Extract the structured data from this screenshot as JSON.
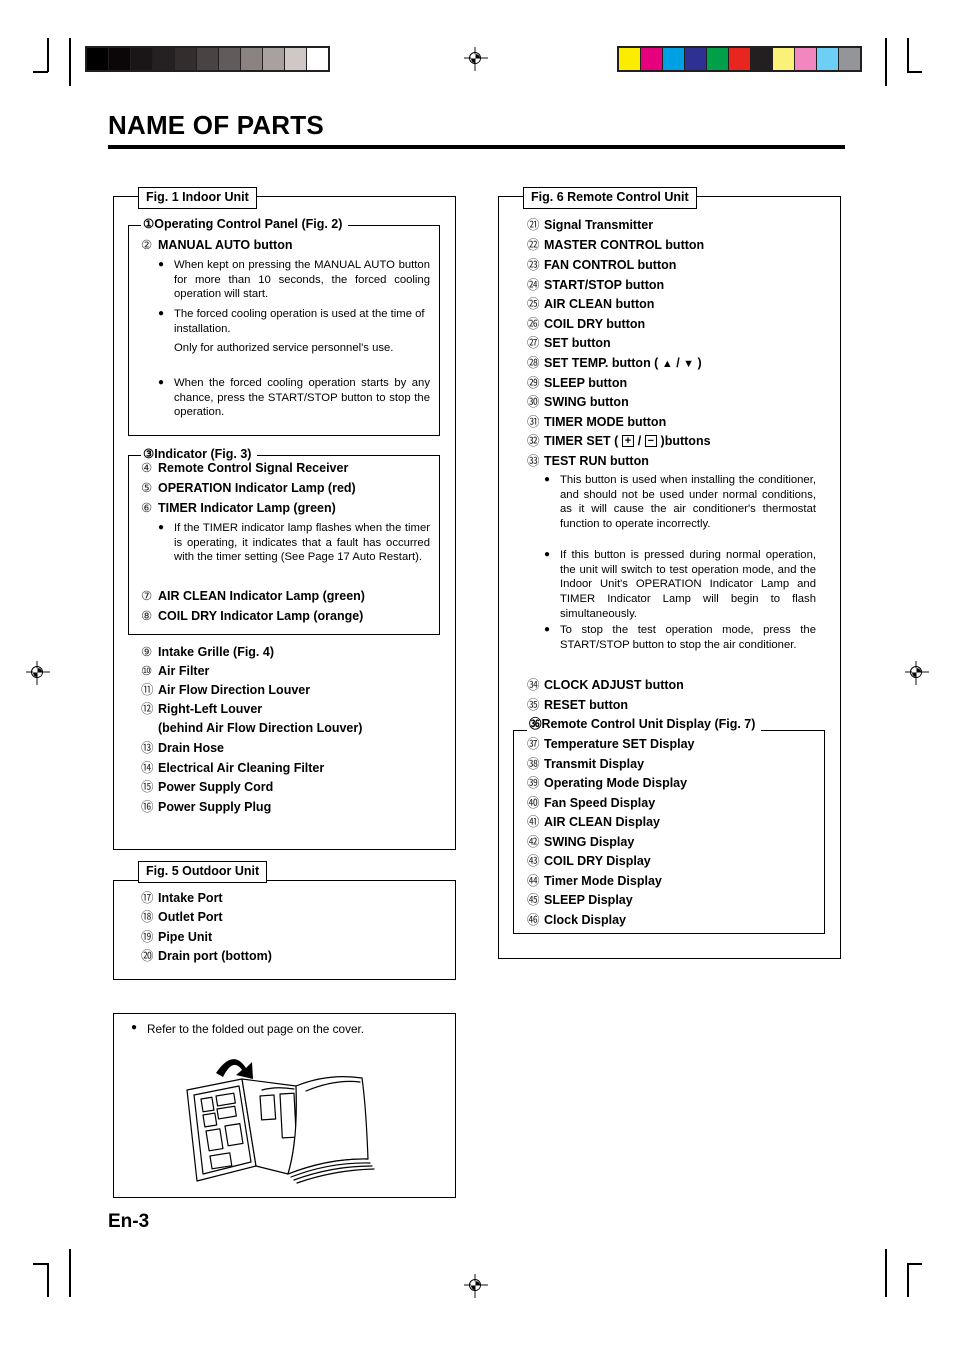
{
  "page": {
    "title": "NAME OF PARTS",
    "folio": "En-3"
  },
  "calibration": {
    "grayscale_bar": [
      "#000000",
      "#0b0708",
      "#1a1517",
      "#252022",
      "#332d2e",
      "#4a4344",
      "#625b5b",
      "#8a8382",
      "#a9a19f",
      "#cfc8c5",
      "#ffffff"
    ],
    "color_bar": [
      "#fced00",
      "#e6007e",
      "#00a0e4",
      "#2e3192",
      "#00a04a",
      "#e8251f",
      "#231f20",
      "#fbf07a",
      "#f287c0",
      "#6dcff6",
      "#939598"
    ]
  },
  "indoor_unit": {
    "label": "Fig. 1 Indoor Unit",
    "control_panel_group": {
      "label": "① Operating Control Panel (Fig. 2)",
      "items": [
        {
          "num": "①",
          "text": "Operating Control Panel (Fig. 2)"
        },
        {
          "num": "②",
          "text": "MANUAL AUTO button"
        }
      ],
      "bullets": [
        "When kept on pressing the MANUAL AUTO button for more than 10 seconds, the forced cooling operation will start.",
        "The forced cooling operation is used at the time of installation.",
        "Only for authorized service personnel's use.",
        "When the forced cooling operation starts by any chance, press the START/STOP button to stop the operation."
      ]
    },
    "indicator_group": {
      "label": "Indicator (Fig. 3)",
      "label_num": "③",
      "items": [
        {
          "num": "④",
          "text": "Remote Control Signal Receiver"
        },
        {
          "num": "⑤",
          "text": "OPERATION Indicator Lamp (red)"
        },
        {
          "num": "⑥",
          "text": "TIMER Indicator Lamp (green)"
        }
      ],
      "bullets": [
        "If the TIMER indicator lamp flashes when the timer is operating, it indicates that a fault has occurred with the timer setting (See Page 17 Auto Restart)."
      ],
      "items_after": [
        {
          "num": "⑦",
          "text": "AIR CLEAN Indicator Lamp (green)"
        },
        {
          "num": "⑧",
          "text": "COIL DRY Indicator Lamp (orange)"
        }
      ]
    },
    "items": [
      {
        "num": "⑨",
        "text": "Intake Grille (Fig. 4)"
      },
      {
        "num": "⑩",
        "text": "Air Filter"
      },
      {
        "num": "⑪",
        "text": "Air Flow Direction Louver"
      },
      {
        "num": "⑫",
        "text": "Right-Left Louver"
      },
      {
        "num": "",
        "text": "(behind Air Flow Direction Louver)"
      },
      {
        "num": "⑬",
        "text": "Drain Hose"
      },
      {
        "num": "⑭",
        "text": "Electrical Air Cleaning Filter"
      },
      {
        "num": "⑮",
        "text": "Power Supply Cord"
      },
      {
        "num": "⑯",
        "text": "Power Supply Plug"
      }
    ]
  },
  "outdoor_unit": {
    "label": "Fig. 5 Outdoor Unit",
    "items": [
      {
        "num": "⑰",
        "text": "Intake Port"
      },
      {
        "num": "⑱",
        "text": "Outlet Port"
      },
      {
        "num": "⑲",
        "text": "Pipe Unit"
      },
      {
        "num": "⑳",
        "text": "Drain port (bottom)"
      }
    ]
  },
  "remote_control": {
    "label": "Fig. 6 Remote Control Unit",
    "items": [
      {
        "num": "㉑",
        "text": "Signal Transmitter"
      },
      {
        "num": "㉒",
        "text": "MASTER CONTROL button"
      },
      {
        "num": "㉓",
        "text": "FAN CONTROL button"
      },
      {
        "num": "㉔",
        "text": "START/STOP button"
      },
      {
        "num": "㉕",
        "text": "AIR CLEAN button"
      },
      {
        "num": "㉖",
        "text": "COIL DRY button"
      },
      {
        "num": "㉗",
        "text": "SET button"
      },
      {
        "num": "㉘",
        "text": "SET TEMP.  button ( ▲ / ▼ )"
      },
      {
        "num": "㉙",
        "text": "SLEEP button"
      },
      {
        "num": "㉚",
        "text": "SWING button"
      },
      {
        "num": "㉛",
        "text": "TIMER MODE button"
      },
      {
        "num": "㉜",
        "text": "TIMER SET ( + / − )buttons"
      },
      {
        "num": "㉝",
        "text": "TEST RUN button"
      }
    ],
    "set_temp": {
      "num": "㉘",
      "prefix": "SET TEMP.  button ( ",
      "up": "▲",
      "sep": " / ",
      "down": "▼",
      "suffix": " )"
    },
    "timer_set": {
      "num": "㉜",
      "prefix": "TIMER SET ( ",
      "plus": "+",
      "sep": " / ",
      "minus": "−",
      "suffix": " )buttons"
    },
    "test_run_bullets": [
      "This button is used when installing the conditioner, and should not be used under normal conditions, as it will cause the air conditioner's thermostat function to operate incorrectly.",
      "If this button is pressed during normal operation, the unit will switch to test operation mode, and the Indoor Unit's OPERATION Indicator Lamp and TIMER Indicator Lamp will begin to flash simultaneously.",
      "To stop the test operation mode, press the START/STOP button to stop the air conditioner."
    ],
    "items_after": [
      {
        "num": "㉞",
        "text": "CLOCK ADJUST button"
      },
      {
        "num": "㉟",
        "text": "RESET button"
      }
    ],
    "display_group": {
      "label": "Remote Control Unit Display (Fig. 7)",
      "label_num": "㊱",
      "items": [
        {
          "num": "㊲",
          "text": "Temperature SET Display"
        },
        {
          "num": "㊳",
          "text": "Transmit Display"
        },
        {
          "num": "㊴",
          "text": "Operating Mode Display"
        },
        {
          "num": "㊵",
          "text": "Fan Speed Display"
        },
        {
          "num": "㊶",
          "text": "AIR CLEAN Display"
        },
        {
          "num": "㊷",
          "text": "SWING Display"
        },
        {
          "num": "㊸",
          "text": "COIL DRY Display"
        },
        {
          "num": "㊹",
          "text": "Timer Mode Display"
        },
        {
          "num": "㊺",
          "text": "SLEEP Display"
        },
        {
          "num": "㊻",
          "text": "Clock Display"
        }
      ]
    }
  },
  "cover_note": {
    "bullet": "Refer to the folded out page on the cover."
  }
}
